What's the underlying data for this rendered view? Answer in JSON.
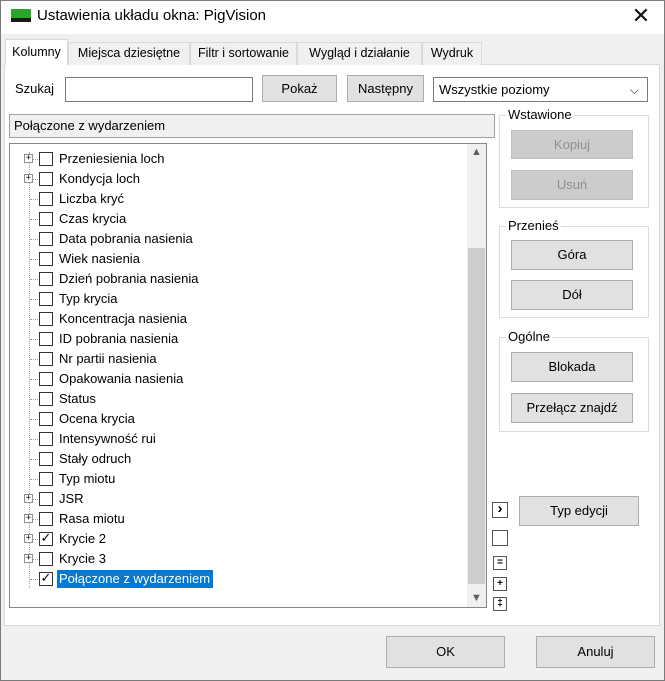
{
  "window": {
    "title": "Ustawienia układu okna: PigVision",
    "close_symbol": "✕"
  },
  "tabs": [
    {
      "label": "Kolumny",
      "active": true
    },
    {
      "label": "Miejsca dziesiętne",
      "active": false
    },
    {
      "label": "Filtr i sortowanie",
      "active": false
    },
    {
      "label": "Wygląd i działanie",
      "active": false
    },
    {
      "label": "Wydruk",
      "active": false
    }
  ],
  "search": {
    "label": "Szukaj",
    "value": "",
    "show_button": "Pokaż",
    "next_button": "Następny"
  },
  "level_select": {
    "value": "Wszystkie poziomy",
    "chevron": "⌵"
  },
  "info_bar": {
    "text": "Połączone z wydarzeniem"
  },
  "tree": {
    "items": [
      {
        "label": "Przeniesienia loch",
        "checked": false,
        "expandable": true,
        "selected": false
      },
      {
        "label": "Kondycja loch",
        "checked": false,
        "expandable": true,
        "selected": false
      },
      {
        "label": "Liczba kryć",
        "checked": false,
        "expandable": false,
        "selected": false
      },
      {
        "label": "Czas krycia",
        "checked": false,
        "expandable": false,
        "selected": false
      },
      {
        "label": "Data pobrania nasienia",
        "checked": false,
        "expandable": false,
        "selected": false
      },
      {
        "label": "Wiek nasienia",
        "checked": false,
        "expandable": false,
        "selected": false
      },
      {
        "label": "Dzień pobrania nasienia",
        "checked": false,
        "expandable": false,
        "selected": false
      },
      {
        "label": "Typ krycia",
        "checked": false,
        "expandable": false,
        "selected": false
      },
      {
        "label": "Koncentracja nasienia",
        "checked": false,
        "expandable": false,
        "selected": false
      },
      {
        "label": "ID pobrania nasienia",
        "checked": false,
        "expandable": false,
        "selected": false
      },
      {
        "label": "Nr partii nasienia",
        "checked": false,
        "expandable": false,
        "selected": false
      },
      {
        "label": "Opakowania nasienia",
        "checked": false,
        "expandable": false,
        "selected": false
      },
      {
        "label": "Status",
        "checked": false,
        "expandable": false,
        "selected": false
      },
      {
        "label": "Ocena krycia",
        "checked": false,
        "expandable": false,
        "selected": false
      },
      {
        "label": "Intensywność rui",
        "checked": false,
        "expandable": false,
        "selected": false
      },
      {
        "label": "Stały odruch",
        "checked": false,
        "expandable": false,
        "selected": false
      },
      {
        "label": "Typ miotu",
        "checked": false,
        "expandable": false,
        "selected": false
      },
      {
        "label": "JSR",
        "checked": false,
        "expandable": true,
        "selected": false
      },
      {
        "label": "Rasa miotu",
        "checked": false,
        "expandable": true,
        "selected": false
      },
      {
        "label": "Krycie 2",
        "checked": true,
        "expandable": true,
        "selected": false
      },
      {
        "label": "Krycie 3",
        "checked": false,
        "expandable": true,
        "selected": false
      },
      {
        "label": "Połączone z wydarzeniem",
        "checked": true,
        "expandable": false,
        "selected": true
      }
    ],
    "expander_symbol": "+",
    "check_symbol": "✓",
    "scroll_up": "▲",
    "scroll_down": "▼"
  },
  "side_controls": {
    "arrow_right": "›",
    "blank": "",
    "collapse": "=",
    "expand": "+",
    "expand_all": "‡"
  },
  "groups": {
    "inserted": {
      "title": "Wstawione",
      "copy_button": "Kopiuj",
      "delete_button": "Usuń"
    },
    "move": {
      "title": "Przenieś",
      "up_button": "Góra",
      "down_button": "Dół"
    },
    "general": {
      "title": "Ogólne",
      "lock_button": "Blokada",
      "toggle_found_button": "Przełącz znajdź"
    },
    "edit_type_button": "Typ edycji"
  },
  "footer": {
    "ok_button": "OK",
    "cancel_button": "Anuluj"
  }
}
